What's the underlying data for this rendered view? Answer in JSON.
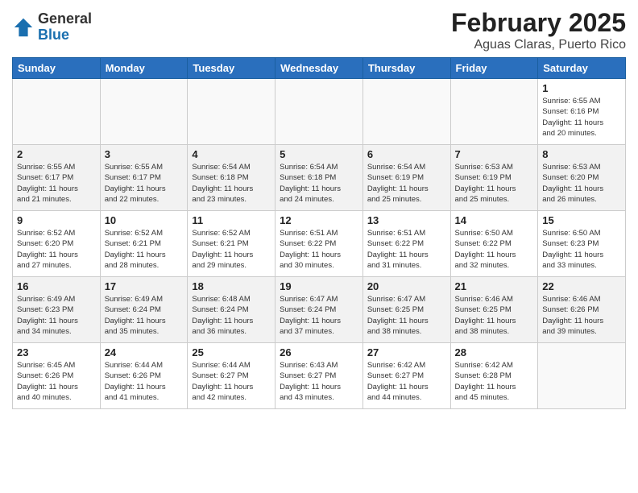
{
  "logo": {
    "general": "General",
    "blue": "Blue"
  },
  "header": {
    "month": "February 2025",
    "location": "Aguas Claras, Puerto Rico"
  },
  "days_of_week": [
    "Sunday",
    "Monday",
    "Tuesday",
    "Wednesday",
    "Thursday",
    "Friday",
    "Saturday"
  ],
  "weeks": [
    [
      {
        "day": "",
        "info": ""
      },
      {
        "day": "",
        "info": ""
      },
      {
        "day": "",
        "info": ""
      },
      {
        "day": "",
        "info": ""
      },
      {
        "day": "",
        "info": ""
      },
      {
        "day": "",
        "info": ""
      },
      {
        "day": "1",
        "info": "Sunrise: 6:55 AM\nSunset: 6:16 PM\nDaylight: 11 hours\nand 20 minutes."
      }
    ],
    [
      {
        "day": "2",
        "info": "Sunrise: 6:55 AM\nSunset: 6:17 PM\nDaylight: 11 hours\nand 21 minutes."
      },
      {
        "day": "3",
        "info": "Sunrise: 6:55 AM\nSunset: 6:17 PM\nDaylight: 11 hours\nand 22 minutes."
      },
      {
        "day": "4",
        "info": "Sunrise: 6:54 AM\nSunset: 6:18 PM\nDaylight: 11 hours\nand 23 minutes."
      },
      {
        "day": "5",
        "info": "Sunrise: 6:54 AM\nSunset: 6:18 PM\nDaylight: 11 hours\nand 24 minutes."
      },
      {
        "day": "6",
        "info": "Sunrise: 6:54 AM\nSunset: 6:19 PM\nDaylight: 11 hours\nand 25 minutes."
      },
      {
        "day": "7",
        "info": "Sunrise: 6:53 AM\nSunset: 6:19 PM\nDaylight: 11 hours\nand 25 minutes."
      },
      {
        "day": "8",
        "info": "Sunrise: 6:53 AM\nSunset: 6:20 PM\nDaylight: 11 hours\nand 26 minutes."
      }
    ],
    [
      {
        "day": "9",
        "info": "Sunrise: 6:52 AM\nSunset: 6:20 PM\nDaylight: 11 hours\nand 27 minutes."
      },
      {
        "day": "10",
        "info": "Sunrise: 6:52 AM\nSunset: 6:21 PM\nDaylight: 11 hours\nand 28 minutes."
      },
      {
        "day": "11",
        "info": "Sunrise: 6:52 AM\nSunset: 6:21 PM\nDaylight: 11 hours\nand 29 minutes."
      },
      {
        "day": "12",
        "info": "Sunrise: 6:51 AM\nSunset: 6:22 PM\nDaylight: 11 hours\nand 30 minutes."
      },
      {
        "day": "13",
        "info": "Sunrise: 6:51 AM\nSunset: 6:22 PM\nDaylight: 11 hours\nand 31 minutes."
      },
      {
        "day": "14",
        "info": "Sunrise: 6:50 AM\nSunset: 6:22 PM\nDaylight: 11 hours\nand 32 minutes."
      },
      {
        "day": "15",
        "info": "Sunrise: 6:50 AM\nSunset: 6:23 PM\nDaylight: 11 hours\nand 33 minutes."
      }
    ],
    [
      {
        "day": "16",
        "info": "Sunrise: 6:49 AM\nSunset: 6:23 PM\nDaylight: 11 hours\nand 34 minutes."
      },
      {
        "day": "17",
        "info": "Sunrise: 6:49 AM\nSunset: 6:24 PM\nDaylight: 11 hours\nand 35 minutes."
      },
      {
        "day": "18",
        "info": "Sunrise: 6:48 AM\nSunset: 6:24 PM\nDaylight: 11 hours\nand 36 minutes."
      },
      {
        "day": "19",
        "info": "Sunrise: 6:47 AM\nSunset: 6:24 PM\nDaylight: 11 hours\nand 37 minutes."
      },
      {
        "day": "20",
        "info": "Sunrise: 6:47 AM\nSunset: 6:25 PM\nDaylight: 11 hours\nand 38 minutes."
      },
      {
        "day": "21",
        "info": "Sunrise: 6:46 AM\nSunset: 6:25 PM\nDaylight: 11 hours\nand 38 minutes."
      },
      {
        "day": "22",
        "info": "Sunrise: 6:46 AM\nSunset: 6:26 PM\nDaylight: 11 hours\nand 39 minutes."
      }
    ],
    [
      {
        "day": "23",
        "info": "Sunrise: 6:45 AM\nSunset: 6:26 PM\nDaylight: 11 hours\nand 40 minutes."
      },
      {
        "day": "24",
        "info": "Sunrise: 6:44 AM\nSunset: 6:26 PM\nDaylight: 11 hours\nand 41 minutes."
      },
      {
        "day": "25",
        "info": "Sunrise: 6:44 AM\nSunset: 6:27 PM\nDaylight: 11 hours\nand 42 minutes."
      },
      {
        "day": "26",
        "info": "Sunrise: 6:43 AM\nSunset: 6:27 PM\nDaylight: 11 hours\nand 43 minutes."
      },
      {
        "day": "27",
        "info": "Sunrise: 6:42 AM\nSunset: 6:27 PM\nDaylight: 11 hours\nand 44 minutes."
      },
      {
        "day": "28",
        "info": "Sunrise: 6:42 AM\nSunset: 6:28 PM\nDaylight: 11 hours\nand 45 minutes."
      },
      {
        "day": "",
        "info": ""
      }
    ]
  ]
}
